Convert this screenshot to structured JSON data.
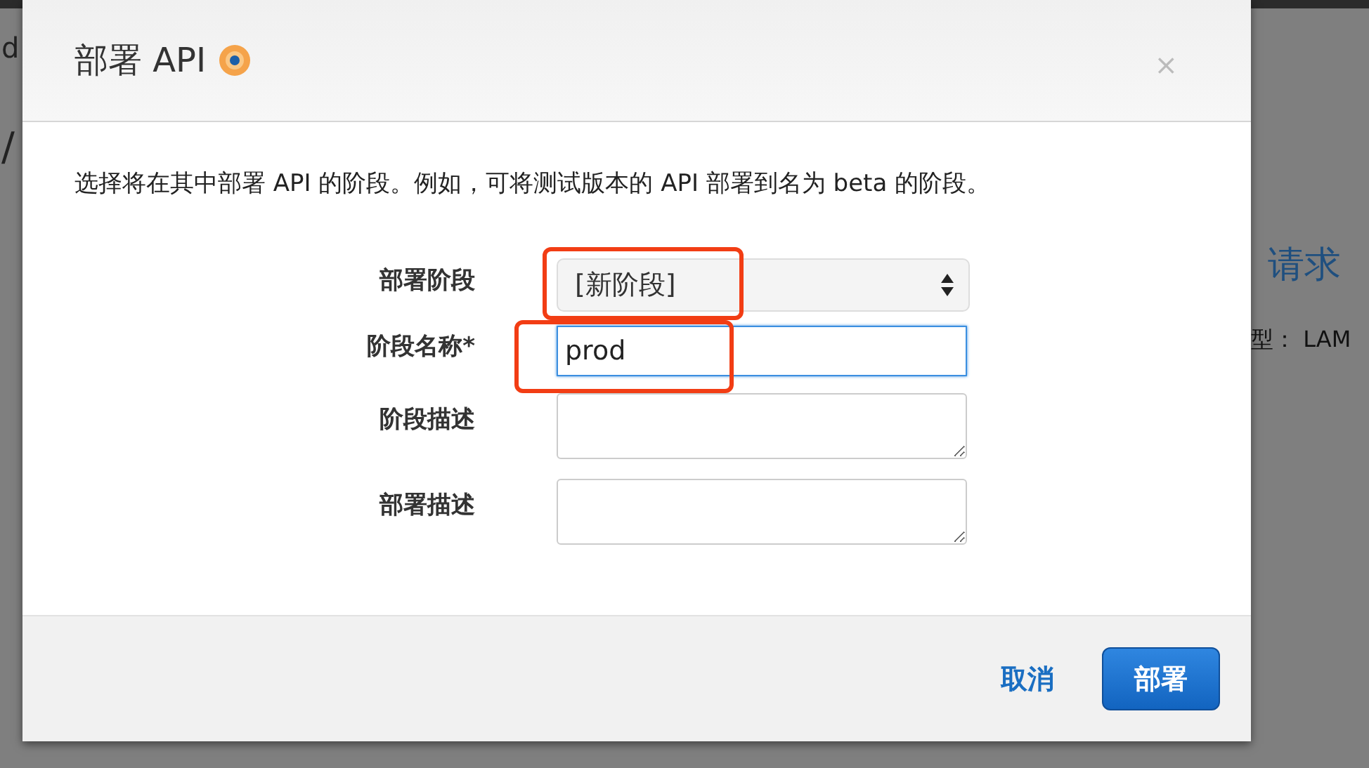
{
  "background": {
    "left_texts": [
      "d",
      "/"
    ],
    "right_heading": "请求",
    "right_text": "型： LAM"
  },
  "dialog": {
    "title": "部署 API",
    "close": "×",
    "intro": "选择将在其中部署 API 的阶段。例如，可将测试版本的 API 部署到名为 beta 的阶段。",
    "fields": [
      {
        "kind": "select",
        "label": "部署阶段",
        "value": "[新阶段]",
        "highlighted": true,
        "focused": false
      },
      {
        "kind": "text",
        "label": "阶段名称*",
        "value": "prod",
        "highlighted": true,
        "focused": true
      },
      {
        "kind": "textarea",
        "label": "阶段描述",
        "highlighted": false,
        "focused": false
      },
      {
        "kind": "textarea",
        "label": "部署描述",
        "highlighted": false,
        "focused": false
      }
    ],
    "buttons": [
      {
        "label": "取消",
        "kind": "link"
      },
      {
        "label": "部署",
        "kind": "primary"
      }
    ]
  }
}
